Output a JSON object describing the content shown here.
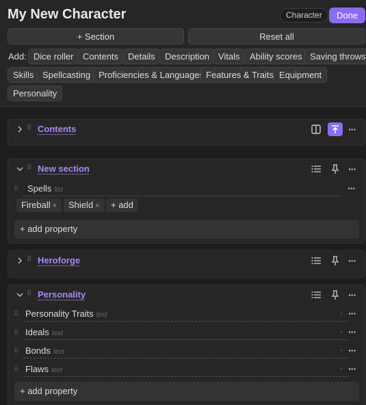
{
  "header": {
    "title": "My New Character",
    "mode_label": "Character",
    "done_label": "Done",
    "add_section_label": "+ Section",
    "reset_label": "Reset all",
    "add_label": "Add:",
    "add_chips": [
      "Dice roller",
      "Contents",
      "Details",
      "Description",
      "Vitals",
      "Ability scores",
      "Saving throws",
      "Skills",
      "Spellcasting",
      "Proficiencies & Languages",
      "Features & Traits",
      "Equipment",
      "Personality"
    ]
  },
  "sections": [
    {
      "title": "Contents",
      "expanded": false
    },
    {
      "title": "New section",
      "expanded": true,
      "properties": [
        {
          "name": "Spells",
          "type": "list",
          "items": [
            "Fireball",
            "Shield"
          ],
          "add_item_label": "+ add"
        }
      ],
      "add_property_label": "+ add property"
    },
    {
      "title": "Heroforge",
      "expanded": false
    },
    {
      "title": "Personality",
      "expanded": true,
      "properties": [
        {
          "name": "Personality Traits",
          "type": "text",
          "value": "-"
        },
        {
          "name": "Ideals",
          "type": "text",
          "value": "-"
        },
        {
          "name": "Bonds",
          "type": "text",
          "value": "-"
        },
        {
          "name": "Flaws",
          "type": "text",
          "value": "-"
        }
      ],
      "add_property_label": "+ add property"
    }
  ],
  "icons": {
    "chevron_right": "chevron-right-icon",
    "chevron_down": "chevron-down-icon",
    "grip": "drag-handle-icon",
    "columns": "columns-icon",
    "pin_top": "pin-to-top-icon",
    "list": "list-icon",
    "pin": "pin-icon",
    "more": "more-icon"
  },
  "colors": {
    "accent": "#8b6cef",
    "section_title": "#a987f5",
    "background": "#1e1e1e"
  }
}
